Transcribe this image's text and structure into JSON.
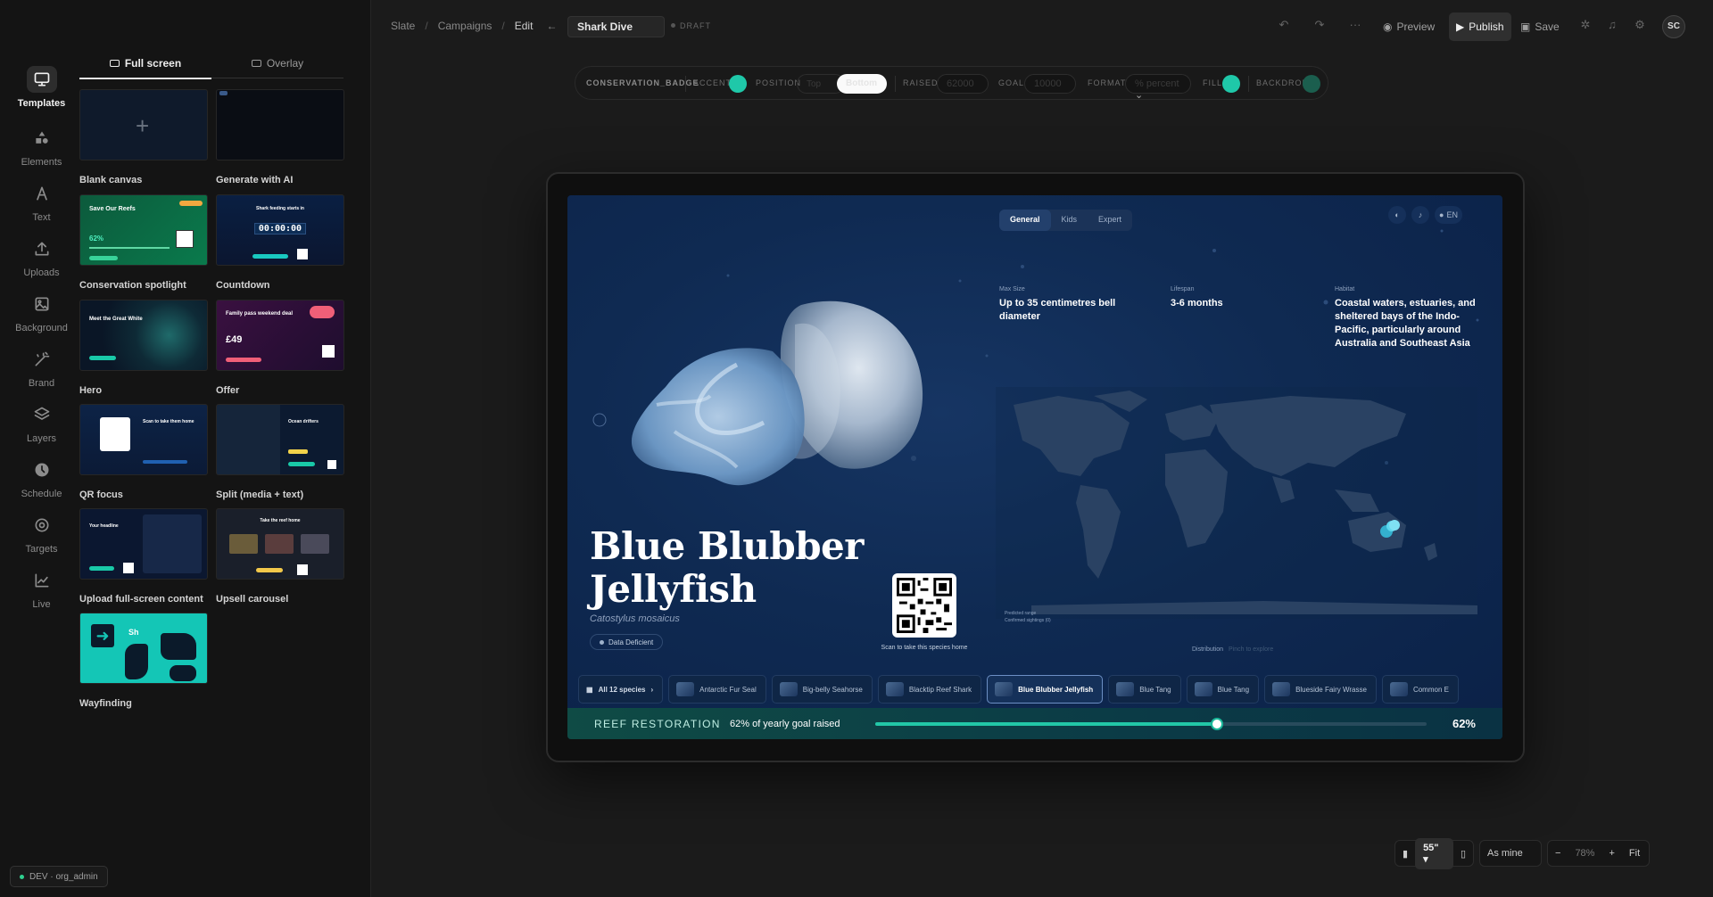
{
  "rail": {
    "items": [
      {
        "label": "Templates",
        "icon": "monitor-icon",
        "active": true
      },
      {
        "label": "Elements",
        "icon": "shapes-icon"
      },
      {
        "label": "Text",
        "icon": "text-icon"
      },
      {
        "label": "Uploads",
        "icon": "upload-icon"
      },
      {
        "label": "Background",
        "icon": "image-icon"
      },
      {
        "label": "Brand",
        "icon": "wand-icon"
      },
      {
        "label": "Layers",
        "icon": "layers-icon"
      },
      {
        "label": "Schedule",
        "icon": "clock-icon"
      },
      {
        "label": "Targets",
        "icon": "target-icon"
      },
      {
        "label": "Live",
        "icon": "chart-icon"
      }
    ]
  },
  "panel": {
    "tabs": [
      "Full screen",
      "Overlay"
    ],
    "templates": [
      {
        "name": "Blank canvas"
      },
      {
        "name": "Generate with AI"
      },
      {
        "name": "Conservation spotlight",
        "thumb_title": "Save Our Reefs",
        "thumb_value": "62%"
      },
      {
        "name": "Countdown",
        "thumb_title": "Shark feeding starts in",
        "thumb_value": "00:00:00"
      },
      {
        "name": "Hero",
        "thumb_title": "Meet the Great White"
      },
      {
        "name": "Offer",
        "thumb_title": "Family pass weekend deal",
        "thumb_value": "£49"
      },
      {
        "name": "QR focus",
        "thumb_title": "Scan to take them home"
      },
      {
        "name": "Split (media + text)",
        "thumb_title": "Ocean drifters"
      },
      {
        "name": "Upload full-screen content",
        "thumb_title": "Your headline"
      },
      {
        "name": "Upsell carousel",
        "thumb_title": "Take the reef home"
      },
      {
        "name": "Wayfinding",
        "thumb_title": "Sh"
      }
    ]
  },
  "topbar": {
    "crumbs": [
      "Slate",
      "Campaigns",
      "Edit"
    ],
    "title": "Shark Dive",
    "status": "DRAFT",
    "preview": "Preview",
    "publish": "Publish",
    "save": "Save",
    "avatar": "SC"
  },
  "props": {
    "component": "CONSERVATION_BADGE",
    "accent_label": "ACCENT",
    "accent_color": "#1fc8a9",
    "position_label": "POSITION",
    "position_options": [
      "Top",
      "Bottom"
    ],
    "position_selected": "Bottom",
    "raised_label": "RAISED",
    "raised_value": "62000",
    "goal_label": "GOAL",
    "goal_value": "10000",
    "format_label": "FORMAT",
    "format_value": "% percent",
    "fill_label": "FILL",
    "fill_color": "#1fc8a9",
    "backdrop_label": "BACKDROP",
    "backdrop_color": "#1b5e4e"
  },
  "screen": {
    "mode_tabs": [
      "General",
      "Kids",
      "Expert"
    ],
    "mode_active": "General",
    "lang": "EN",
    "facts": [
      {
        "label": "Max Size",
        "value": "Up to 35 centimetres bell diameter"
      },
      {
        "label": "Lifespan",
        "value": "3-6 months"
      },
      {
        "label": "Habitat",
        "value": "Coastal waters, estuaries, and sheltered bays of the Indo-Pacific, particularly around Australia and Southeast Asia"
      }
    ],
    "title": "Blue Blubber Jellyfish",
    "scientific": "Catostylus mosaicus",
    "status": "Data Deficient",
    "qr_caption": "Scan to take this species home",
    "map_legend": [
      "Predicted range",
      "Confirmed sightings (0)"
    ],
    "distribution": "Distribution",
    "distribution_hint": "Pinch to explore",
    "species": [
      "All 12 species",
      "Antarctic Fur Seal",
      "Big-belly Seahorse",
      "Blacktip Reef Shark",
      "Blue Blubber Jellyfish",
      "Blue Tang",
      "Blue Tang",
      "Blueside Fairy Wrasse",
      "Common E"
    ],
    "species_active": "Blue Blubber Jellyfish",
    "goal_label": "REEF RESTORATION",
    "goal_sub": "62% of yearly goal raised",
    "goal_percent": "62%",
    "goal_fraction": 0.62
  },
  "zoom": {
    "size": "55\"",
    "as_mine": "As mine",
    "level": "78%",
    "fit": "Fit"
  },
  "env": "DEV · org_admin"
}
